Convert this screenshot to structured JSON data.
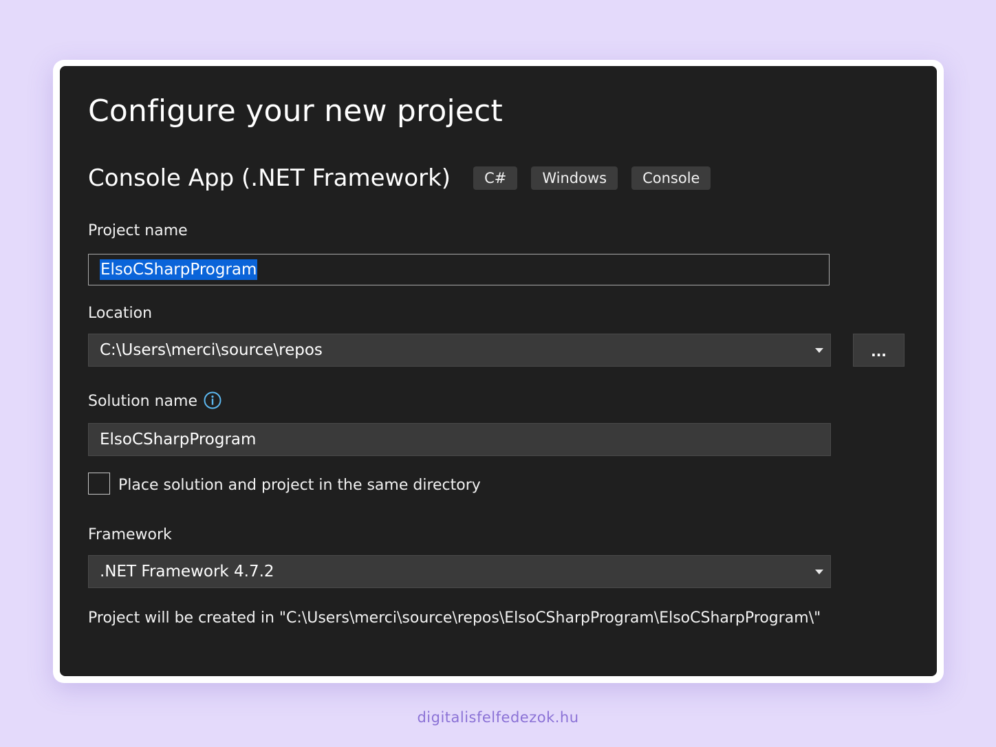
{
  "dialog": {
    "title": "Configure your new project",
    "template": {
      "name": "Console App (.NET Framework)",
      "tags": [
        "C#",
        "Windows",
        "Console"
      ]
    },
    "project_name": {
      "label": "Project name",
      "value": "ElsoCSharpProgram"
    },
    "location": {
      "label": "Location",
      "value": "C:\\Users\\merci\\source\\repos",
      "browse_label": "..."
    },
    "solution_name": {
      "label": "Solution name",
      "value": "ElsoCSharpProgram",
      "info_icon": "info-icon"
    },
    "same_directory": {
      "label": "Place solution and project in the same directory",
      "checked": false
    },
    "framework": {
      "label": "Framework",
      "value": ".NET Framework 4.7.2"
    },
    "path_note": "Project will be created in \"C:\\Users\\merci\\source\\repos\\ElsoCSharpProgram\\ElsoCSharpProgram\\\""
  },
  "footer": {
    "credit": "digitalisfelfedezok.hu"
  },
  "colors": {
    "background": "#e4dafb",
    "dialog": "#1f1f1f",
    "selection": "#0a64d9",
    "info_accent": "#5cb8f0",
    "credit": "#8b72d6"
  }
}
